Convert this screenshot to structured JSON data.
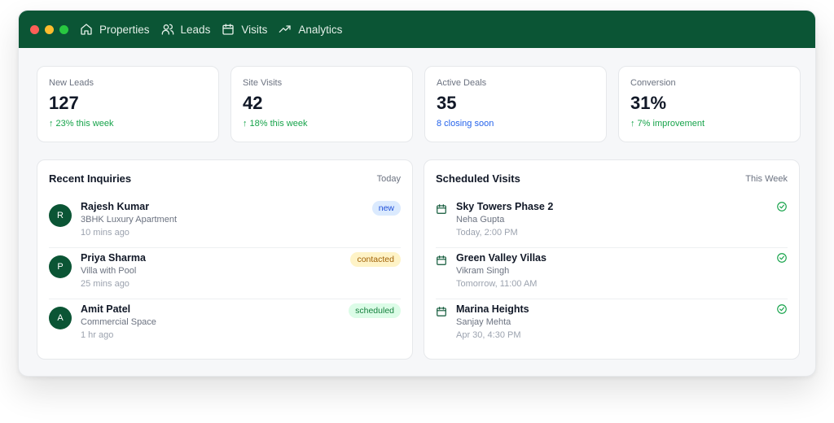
{
  "colors": {
    "brand": "#0b5535",
    "green": "#16a34a",
    "blue": "#2563eb"
  },
  "nav": {
    "items": [
      {
        "label": "Properties",
        "icon": "home-icon"
      },
      {
        "label": "Leads",
        "icon": "users-icon"
      },
      {
        "label": "Visits",
        "icon": "calendar-icon"
      },
      {
        "label": "Analytics",
        "icon": "trending-up-icon"
      }
    ]
  },
  "stats": [
    {
      "label": "New Leads",
      "value": "127",
      "note": "↑ 23% this week"
    },
    {
      "label": "Site Visits",
      "value": "42",
      "note": "↑ 18% this week"
    },
    {
      "label": "Active Deals",
      "value": "35",
      "note": "8 closing soon"
    },
    {
      "label": "Conversion",
      "value": "31%",
      "note": "↑ 7% improvement"
    }
  ],
  "inquiries": {
    "title": "Recent Inquiries",
    "period": "Today",
    "items": [
      {
        "initial": "R",
        "name": "Rajesh Kumar",
        "detail": "3BHK Luxury Apartment",
        "time": "10 mins ago",
        "status": "new"
      },
      {
        "initial": "P",
        "name": "Priya Sharma",
        "detail": "Villa with Pool",
        "time": "25 mins ago",
        "status": "contacted"
      },
      {
        "initial": "A",
        "name": "Amit Patel",
        "detail": "Commercial Space",
        "time": "1 hr ago",
        "status": "scheduled"
      }
    ]
  },
  "visits": {
    "title": "Scheduled Visits",
    "period": "This Week",
    "items": [
      {
        "property": "Sky Towers Phase 2",
        "client": "Neha Gupta",
        "when": "Today, 2:00 PM"
      },
      {
        "property": "Green Valley Villas",
        "client": "Vikram Singh",
        "when": "Tomorrow, 11:00 AM"
      },
      {
        "property": "Marina Heights",
        "client": "Sanjay Mehta",
        "when": "Apr 30, 4:30 PM"
      }
    ]
  }
}
